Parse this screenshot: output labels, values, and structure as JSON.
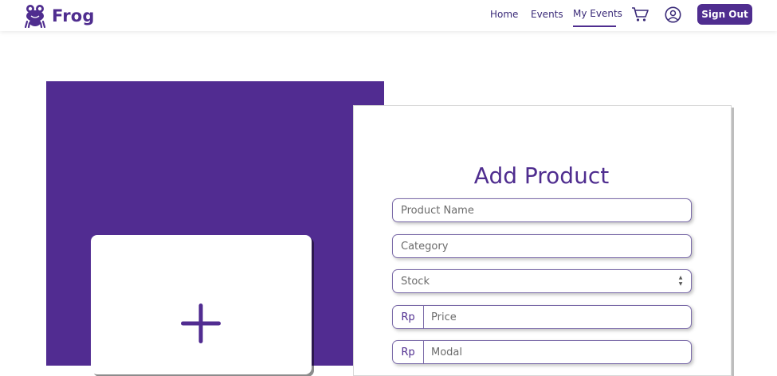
{
  "brand": {
    "name": "Frog",
    "logo_icon": "frog-logo-icon",
    "color": "#4f2d8f"
  },
  "nav": {
    "links": [
      {
        "label": "Home"
      },
      {
        "label": "Events"
      },
      {
        "label": "My Events",
        "active": true
      }
    ],
    "cart_icon": "cart-icon",
    "profile_icon": "user-circle-icon",
    "signout_label": "Sign Out"
  },
  "upload": {
    "icon": "plus-icon",
    "panel_color": "#512c91"
  },
  "form": {
    "title": "Add Product",
    "product_name_placeholder": "Product Name",
    "category_placeholder": "Category",
    "stock_placeholder": "Stock",
    "price_prefix": "Rp",
    "price_placeholder": "Price",
    "modal_prefix": "Rp",
    "modal_placeholder": "Modal"
  }
}
